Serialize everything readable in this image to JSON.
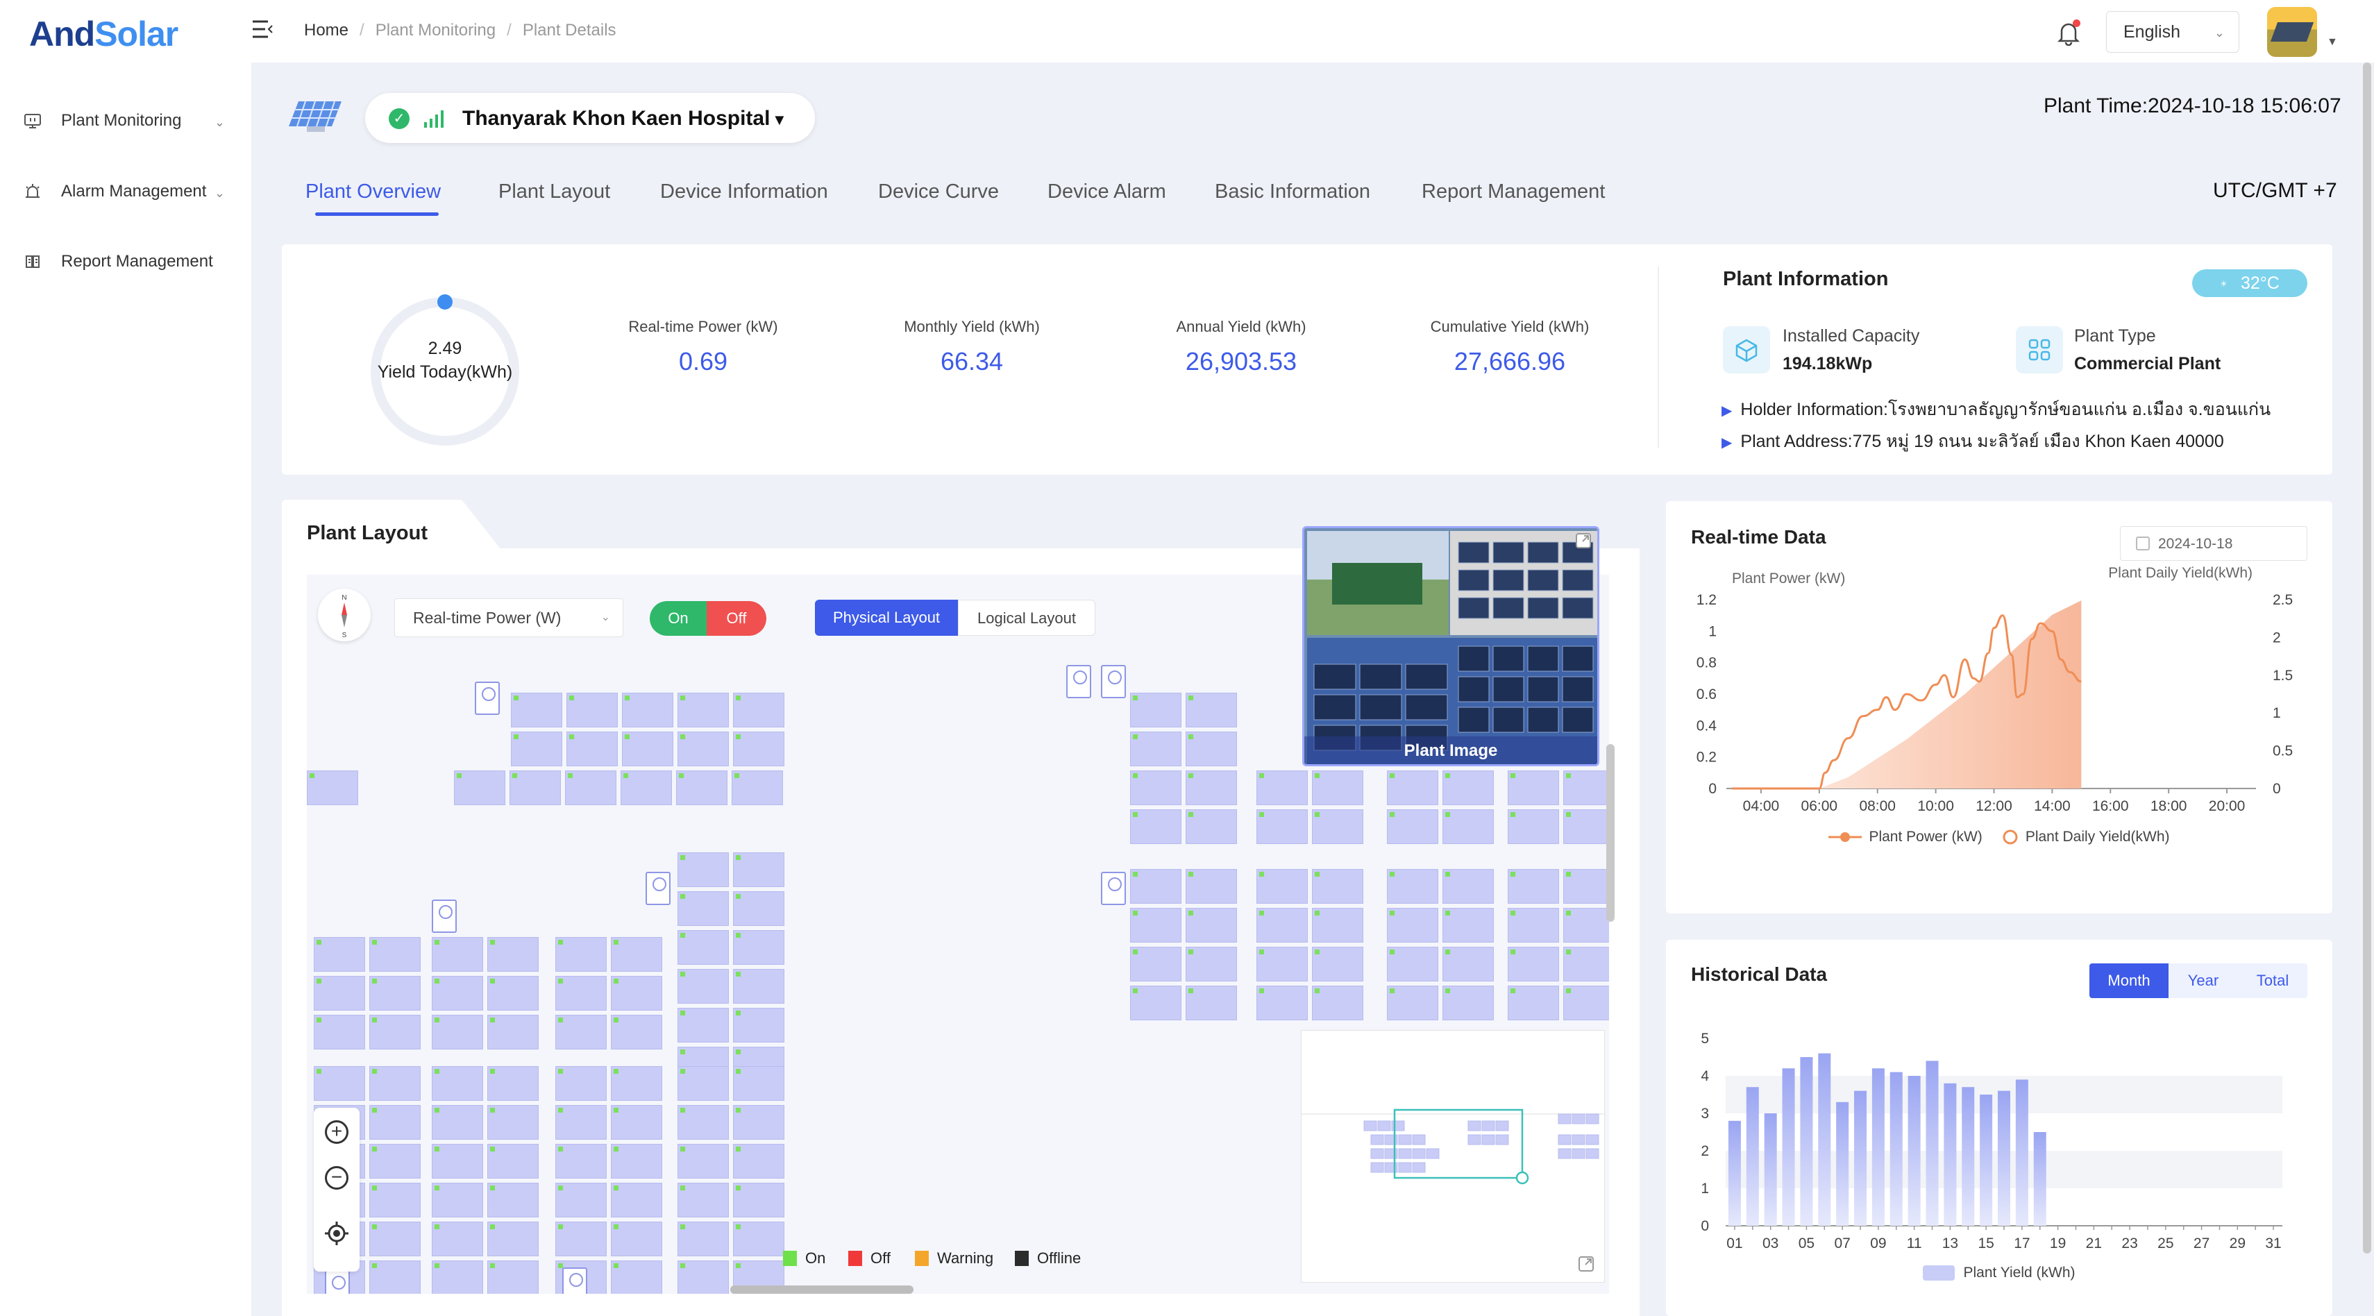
{
  "brand": {
    "part1": "And",
    "part2": "Solar"
  },
  "sidebar": {
    "items": [
      {
        "label": "Plant Monitoring",
        "icon": "monitor-icon"
      },
      {
        "label": "Alarm Management",
        "icon": "alarm-icon"
      },
      {
        "label": "Report Management",
        "icon": "report-icon"
      }
    ]
  },
  "breadcrumb": {
    "home": "Home",
    "sep": "/",
    "level1": "Plant Monitoring",
    "level2": "Plant Details"
  },
  "header": {
    "language": "English"
  },
  "plant": {
    "name": "Thanyarak Khon Kaen Hospital",
    "time": "Plant Time:2024-10-18 15:06:07",
    "timezone": "UTC/GMT +7"
  },
  "tabs": [
    "Plant Overview",
    "Plant Layout",
    "Device Information",
    "Device Curve",
    "Device Alarm",
    "Basic Information",
    "Report Management"
  ],
  "overview": {
    "yield_today_value": "2.49",
    "yield_today_label": "Yield Today(kWh)",
    "metrics": [
      {
        "label": "Real-time Power (kW)",
        "value": "0.69"
      },
      {
        "label": "Monthly Yield (kWh)",
        "value": "66.34"
      },
      {
        "label": "Annual Yield (kWh)",
        "value": "26,903.53"
      },
      {
        "label": "Cumulative Yield (kWh)",
        "value": "27,666.96"
      }
    ]
  },
  "plant_info": {
    "title": "Plant Information",
    "weather_temp": "32°C",
    "capacity_label": "Installed Capacity",
    "capacity_value": "194.18kWp",
    "type_label": "Plant Type",
    "type_value": "Commercial Plant",
    "holder_label": "Holder Information:",
    "holder_value": "โรงพยาบาลธัญญารักษ์ขอนแก่น อ.เมือง จ.ขอนแก่น",
    "address_label": "Plant Address:",
    "address_value": "775 หมู่ 19 ถนน มะลิวัลย์ เมือง Khon Kaen 40000"
  },
  "layout": {
    "title": "Plant Layout",
    "dropdown": "Real-time Power (W)",
    "on": "On",
    "off": "Off",
    "physical": "Physical Layout",
    "logical": "Logical Layout",
    "plant_image_caption": "Plant Image",
    "legend": [
      {
        "label": "On",
        "color": "#6ee04a"
      },
      {
        "label": "Off",
        "color": "#f03a3a"
      },
      {
        "label": "Warning",
        "color": "#f4a62a"
      },
      {
        "label": "Offline",
        "color": "#2b2b2b"
      }
    ],
    "colors": {
      "panel": "#c9ccf6",
      "accent": "#3d5ae8"
    }
  },
  "realtime": {
    "title": "Real-time Data",
    "date": "2024-10-18",
    "left_axis_label": "Plant Power (kW)",
    "right_axis_label": "Plant Daily Yield(kWh)",
    "legend_power": "Plant Power (kW)",
    "legend_yield": "Plant Daily Yield(kWh)"
  },
  "historical": {
    "title": "Historical Data",
    "buttons": [
      "Month",
      "Year",
      "Total"
    ],
    "legend": "Plant Yield (kWh)"
  },
  "chart_data": [
    {
      "type": "line",
      "title": "Real-time Data",
      "x_ticks": [
        "04:00",
        "06:00",
        "08:00",
        "10:00",
        "12:00",
        "14:00",
        "16:00",
        "18:00",
        "20:00"
      ],
      "y_left_ticks": [
        "0",
        "0.2",
        "0.4",
        "0.6",
        "0.8",
        "1",
        "1.2"
      ],
      "y_right_ticks": [
        "0",
        "0.5",
        "1",
        "1.5",
        "2",
        "2.5"
      ],
      "ylim_left": [
        0,
        1.2
      ],
      "ylim_right": [
        0,
        2.5
      ],
      "xlim_hours": [
        3,
        21
      ],
      "series": [
        {
          "name": "Plant Power (kW)",
          "axis": "left",
          "color": "#ef8d55",
          "x": [
            6.0,
            6.2,
            6.5,
            7.0,
            7.5,
            8.0,
            8.3,
            8.6,
            9.0,
            9.5,
            10.0,
            10.3,
            10.6,
            11.0,
            11.3,
            11.5,
            11.8,
            12.0,
            12.3,
            12.6,
            12.8,
            13.0,
            13.3,
            13.6,
            14.0,
            14.3,
            14.6,
            15.0
          ],
          "y": [
            0.0,
            0.1,
            0.18,
            0.32,
            0.46,
            0.5,
            0.58,
            0.5,
            0.6,
            0.56,
            0.66,
            0.72,
            0.58,
            0.82,
            0.7,
            0.68,
            0.86,
            1.02,
            1.1,
            0.85,
            0.58,
            0.6,
            0.95,
            1.05,
            1.0,
            0.82,
            0.74,
            0.68
          ]
        },
        {
          "name": "Plant Daily Yield(kWh)",
          "axis": "right",
          "color": "#f7b79a",
          "x": [
            6.0,
            7.0,
            8.0,
            9.0,
            10.0,
            11.0,
            12.0,
            13.0,
            14.0,
            15.0
          ],
          "y": [
            0.0,
            0.15,
            0.4,
            0.65,
            0.95,
            1.25,
            1.6,
            1.95,
            2.3,
            2.49
          ]
        }
      ]
    },
    {
      "type": "bar",
      "title": "Historical Data",
      "x_ticks": [
        "01",
        "03",
        "05",
        "07",
        "09",
        "11",
        "13",
        "15",
        "17",
        "19",
        "21",
        "23",
        "25",
        "27",
        "29",
        "31"
      ],
      "y_ticks": [
        "0",
        "1",
        "2",
        "3",
        "4",
        "5"
      ],
      "ylim": [
        0,
        5
      ],
      "series": [
        {
          "name": "Plant Yield (kWh)",
          "color": "#aab3f5",
          "days": [
            1,
            2,
            3,
            4,
            5,
            6,
            7,
            8,
            9,
            10,
            11,
            12,
            13,
            14,
            15,
            16,
            17,
            18
          ],
          "values": [
            2.8,
            3.7,
            3.0,
            4.2,
            4.5,
            4.6,
            3.3,
            3.6,
            4.2,
            4.1,
            4.0,
            4.4,
            3.8,
            3.7,
            3.5,
            3.6,
            3.9,
            2.5
          ]
        }
      ]
    }
  ]
}
